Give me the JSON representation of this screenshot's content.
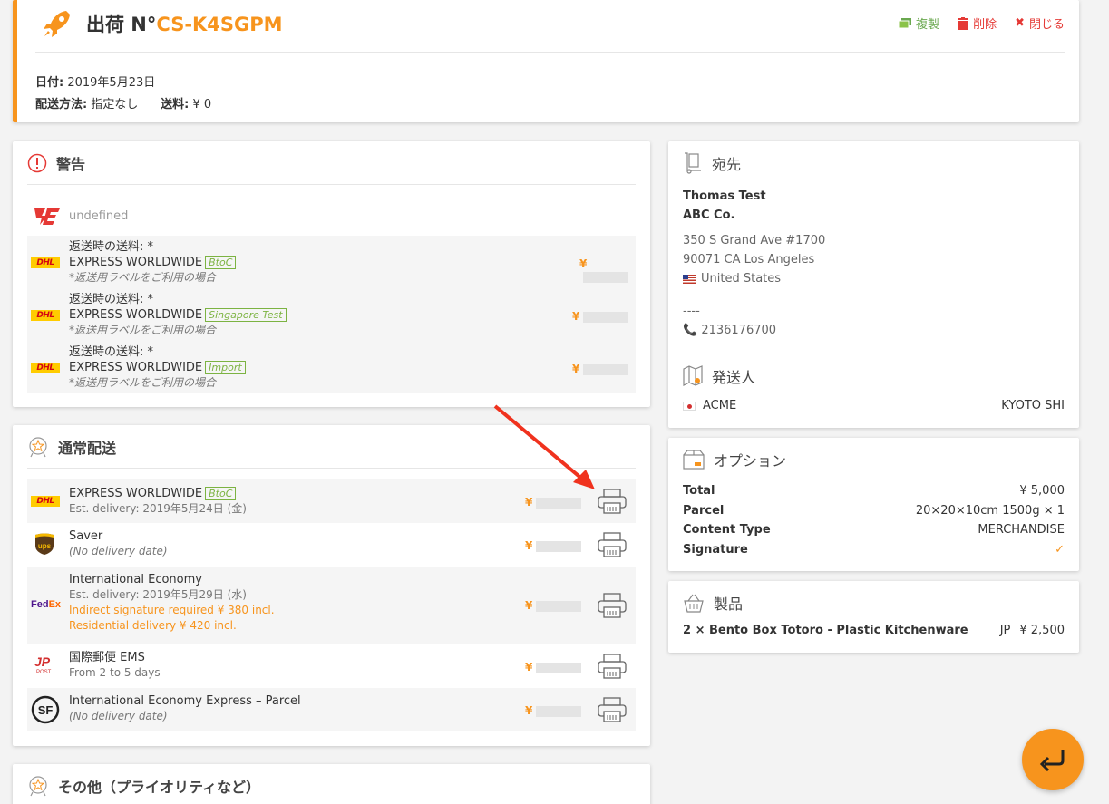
{
  "header": {
    "title_prefix": "出荷 N°",
    "shipment_code": "CS-K4SGPM",
    "actions": {
      "duplicate": "複製",
      "delete": "削除",
      "close": "閉じる"
    },
    "date_label": "日付:",
    "date_value": "2019年5月23日",
    "method_label": "配送方法:",
    "method_value": "指定なし",
    "fee_label": "送料:",
    "fee_value": "¥ 0"
  },
  "warning": {
    "title": "警告",
    "carrier_text": "undefined",
    "rows": [
      {
        "label": "返送時の送料: *",
        "service": "EXPRESS WORLDWIDE",
        "tag": "BtoC",
        "note": "*返送用ラベルをご利用の場合",
        "price": "¥"
      },
      {
        "label": "返送時の送料: *",
        "service": "EXPRESS WORLDWIDE",
        "tag": "Singapore Test",
        "note": "*返送用ラベルをご利用の場合",
        "price": "¥"
      },
      {
        "label": "返送時の送料: *",
        "service": "EXPRESS WORLDWIDE",
        "tag": "Import",
        "note": "*返送用ラベルをご利用の場合",
        "price": "¥"
      }
    ]
  },
  "normal": {
    "title": "通常配送",
    "rows": [
      {
        "carrier": "DHL",
        "service": "EXPRESS WORLDWIDE",
        "tag": "BtoC",
        "sub": "Est. delivery: 2019年5月24日 (金)",
        "price": "¥"
      },
      {
        "carrier": "UPS",
        "service": "Saver",
        "sub": "(No delivery date)",
        "price": "¥"
      },
      {
        "carrier": "FedEx",
        "service": "International Economy",
        "sub": "Est. delivery: 2019年5月29日 (水)",
        "extra1": "Indirect signature required ¥ 380 incl.",
        "extra2": "Residential delivery ¥ 420 incl.",
        "price": "¥"
      },
      {
        "carrier": "JP POST",
        "service": "国際郵便 EMS",
        "sub": "From 2 to 5 days",
        "price": "¥"
      },
      {
        "carrier": "SF",
        "service": "International Economy Express – Parcel",
        "sub": "(No delivery date)",
        "price": "¥"
      }
    ]
  },
  "other": {
    "title": "その他（プライオリティなど）"
  },
  "recipient": {
    "title": "宛先",
    "name": "Thomas Test",
    "company": "ABC Co.",
    "address1": "350 S Grand Ave #1700",
    "address2": "90071 CA Los Angeles",
    "country": "United States",
    "dashes": "----",
    "phone": "2136176700"
  },
  "sender": {
    "title": "発送人",
    "name": "ACME",
    "city": "KYOTO SHI"
  },
  "options": {
    "title": "オプション",
    "total_label": "Total",
    "total_value": "¥ 5,000",
    "parcel_label": "Parcel",
    "parcel_value": "20×20×10cm 1500g × 1",
    "content_label": "Content Type",
    "content_value": "MERCHANDISE",
    "signature_label": "Signature"
  },
  "products": {
    "title": "製品",
    "item": "2 × Bento Box Totoro - Plastic Kitchenware",
    "origin": "JP",
    "price": "¥ 2,500"
  },
  "colors": {
    "accent": "#f7941d",
    "danger": "#e53935",
    "success": "#7cb342"
  }
}
